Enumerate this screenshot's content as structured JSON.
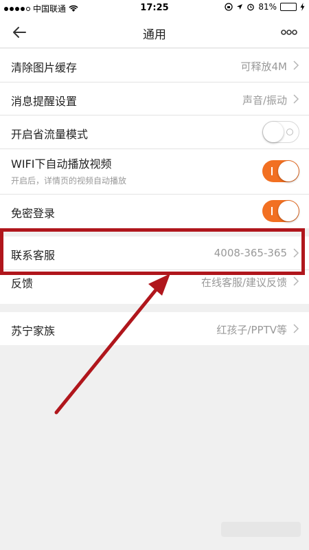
{
  "status_bar": {
    "carrier": "中国联通",
    "time": "17:25",
    "battery": "81%",
    "battery_level": 0.81,
    "icons": [
      "signal-dots",
      "wifi-icon",
      "orientation-lock-icon",
      "location-arrow-icon",
      "alarm-icon",
      "battery-icon",
      "charging-icon"
    ]
  },
  "nav": {
    "title": "通用",
    "back_icon": "back-arrow-icon",
    "more_icon": "more-dots-icon"
  },
  "settings": {
    "clear_cache": {
      "label": "清除图片缓存",
      "value": "可释放4M"
    },
    "notification": {
      "label": "消息提醒设置",
      "value": "声音/振动"
    },
    "data_saver": {
      "label": "开启省流量模式",
      "enabled": false
    },
    "wifi_autoplay": {
      "label": "WIFI下自动播放视频",
      "sub": "开启后，详情页的视频自动播放",
      "enabled": true
    },
    "password_free": {
      "label": "免密登录",
      "enabled": true
    }
  },
  "support": {
    "customer_service": {
      "label": "联系客服",
      "value": "4008-365-365"
    },
    "feedback": {
      "label": "反馈",
      "value": "在线客服/建议反馈"
    }
  },
  "family": {
    "suning_family": {
      "label": "苏宁家族",
      "value": "红孩子/PPTV等"
    }
  },
  "colors": {
    "accent_orange": "#f27022",
    "annotation_red": "#b0161c",
    "background": "#f0f0f0"
  }
}
